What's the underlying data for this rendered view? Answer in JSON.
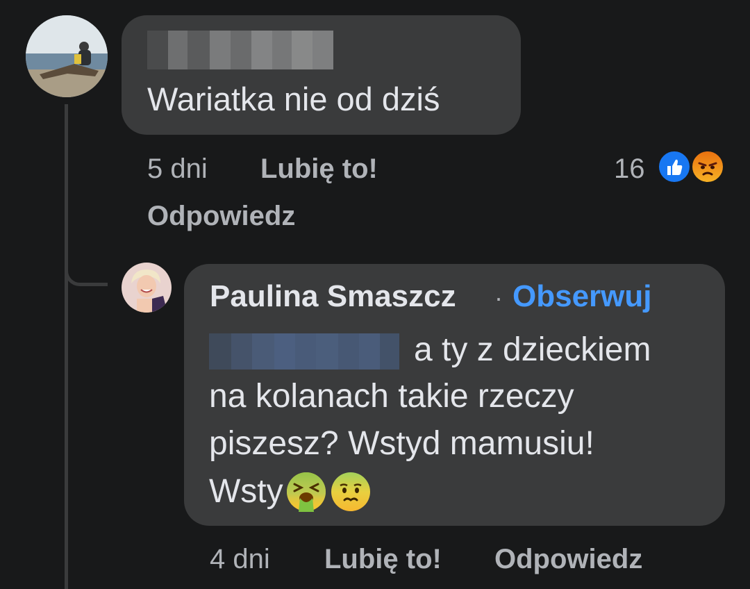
{
  "comment_1": {
    "author": "",
    "text": "Wariatka nie od dziś",
    "time": "5 dni",
    "like_label": "Lubię to!",
    "reply_label": "Odpowiedz",
    "reaction_count": "16",
    "reactions": [
      "like-icon",
      "angry-icon"
    ]
  },
  "comment_2": {
    "author": "Paulina Smaszcz",
    "separator": "·",
    "follow_label": "Obserwuj",
    "text_line_1": "a ty z dzieckiem",
    "text_line_2": "na kolanach takie rzeczy",
    "text_line_3": "piszesz? Wstyd mamusiu!",
    "text_line_4": "Wsty",
    "emojis": [
      "vomiting-face-emoji",
      "nauseated-face-emoji"
    ],
    "time": "4 dni",
    "like_label": "Lubię to!",
    "reply_label": "Odpowiedz"
  },
  "colors": {
    "background": "#18191a",
    "bubble": "#3a3b3c",
    "text": "#e4e6eb",
    "secondary_text": "#b0b3b8",
    "link": "#4599ff",
    "like_blue": "#1877f2"
  }
}
